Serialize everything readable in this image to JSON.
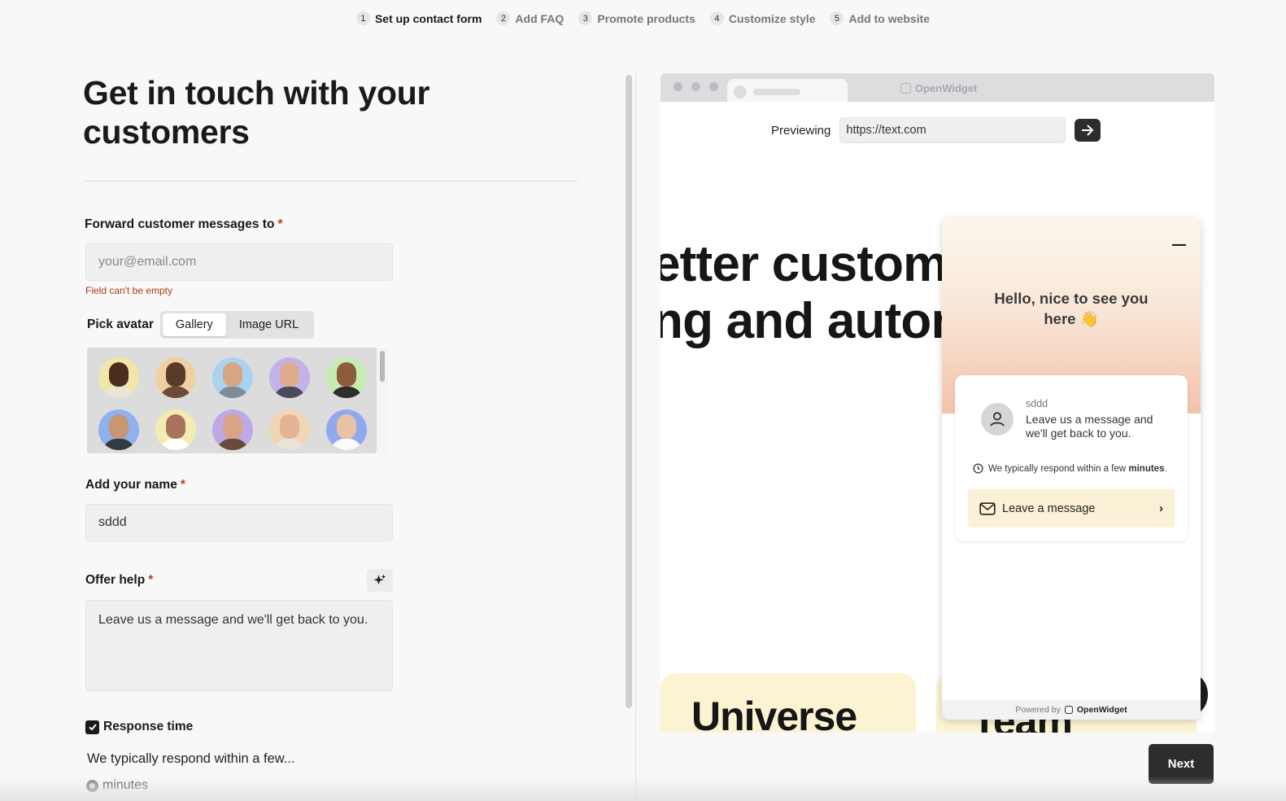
{
  "stepper": [
    {
      "num": "1",
      "label": "Set up contact form",
      "active": true
    },
    {
      "num": "2",
      "label": "Add FAQ"
    },
    {
      "num": "3",
      "label": "Promote products"
    },
    {
      "num": "4",
      "label": "Customize style"
    },
    {
      "num": "5",
      "label": "Add to website"
    }
  ],
  "form": {
    "title": "Get in touch with your customers",
    "forward": {
      "label": "Forward customer messages to",
      "required": "*",
      "placeholder": "your@email.com",
      "value": "",
      "error": "Field can't be empty"
    },
    "avatar": {
      "label": "Pick avatar",
      "tabs": [
        "Gallery",
        "Image URL"
      ],
      "selected_tab": "Gallery",
      "gallery_colors": [
        {
          "bg": "#f1e7a8",
          "skin": "#4a2d1e",
          "shirt": "#e9e4d8"
        },
        {
          "bg": "#f1cfa3",
          "skin": "#5a3a28",
          "shirt": "#6b4b36"
        },
        {
          "bg": "#a9d3ef",
          "skin": "#d8a582",
          "shirt": "#7f8c95"
        },
        {
          "bg": "#c3b2ea",
          "skin": "#e0aa8c",
          "shirt": "#4c4c58"
        },
        {
          "bg": "#c7ecb1",
          "skin": "#8d5c3c",
          "shirt": "#2e2e2e"
        },
        {
          "bg": "#8fb1ef",
          "skin": "#c79672",
          "shirt": "#333a40"
        },
        {
          "bg": "#f3ebb2",
          "skin": "#a8735a",
          "shirt": "#ffffff"
        },
        {
          "bg": "#bda9e6",
          "skin": "#d9a385",
          "shirt": "#6c4a3b"
        },
        {
          "bg": "#f0d6b3",
          "skin": "#e3b394",
          "shirt": "#e8e2d8"
        },
        {
          "bg": "#8ea9ee",
          "skin": "#e8c1a6",
          "shirt": "#fbfbfb"
        }
      ]
    },
    "name": {
      "label": "Add your name",
      "required": "*",
      "value": "sddd"
    },
    "offer": {
      "label": "Offer help",
      "required": "*",
      "value": "Leave us a message and we'll get back to you."
    },
    "response_time": {
      "label": "Response time",
      "checked": true,
      "sub": "We typically respond within a few...",
      "option": "minutes"
    }
  },
  "preview": {
    "chrome_brand": "OpenWidget",
    "label": "Previewing",
    "url": "https://text.com",
    "hero_line1": "etter custome",
    "hero_line2": "ng and autom",
    "card1_text": "Universe",
    "card2_text": "Team"
  },
  "widget": {
    "greeting": "Hello, nice to see you here 👋",
    "agent_name": "sddd",
    "message": "Leave us a message and we'll get back to you.",
    "response_prefix": "We typically respond within a few",
    "response_unit": "minutes",
    "response_suffix": ".",
    "leave_button": "Leave a message",
    "powered_by": "Powered by",
    "brand": "OpenWidget"
  },
  "actions": {
    "next": "Next"
  }
}
